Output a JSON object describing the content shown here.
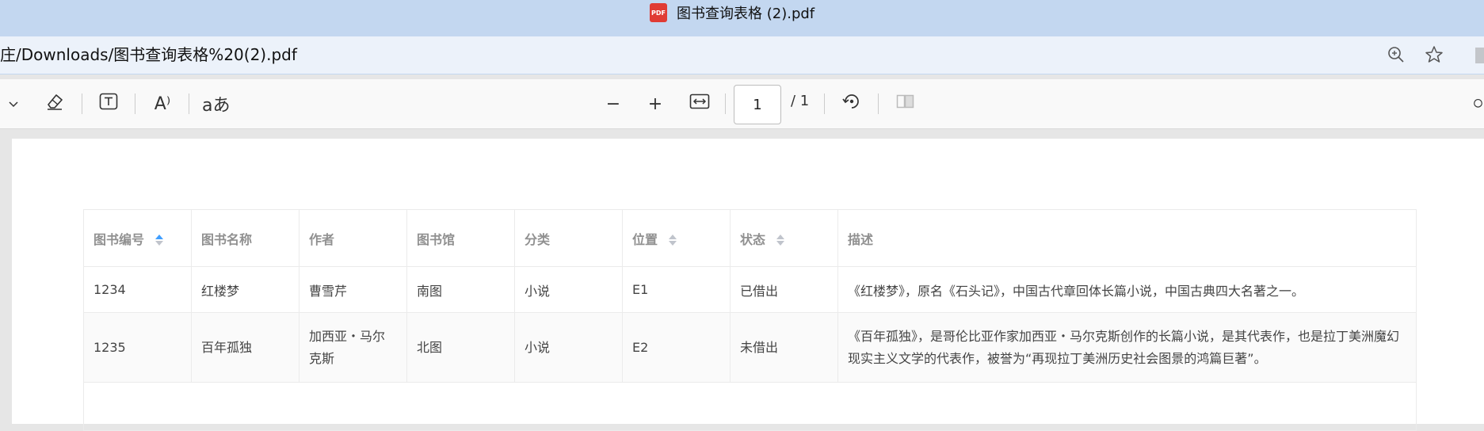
{
  "window": {
    "title": "图书查询表格 (2).pdf",
    "badge": "PDF"
  },
  "address_bar": {
    "url": "庄/Downloads/图书查询表格%20(2).pdf"
  },
  "toolbar": {
    "read_aloud_label": "A⁾",
    "translate_label": "aあ",
    "zoom_out_label": "−",
    "zoom_in_label": "+",
    "page_current": "1",
    "page_total": "/ 1"
  },
  "table": {
    "headers": [
      "图书编号",
      "图书名称",
      "作者",
      "图书馆",
      "分类",
      "位置",
      "状态",
      "描述"
    ],
    "rows": [
      [
        "1234",
        "红楼梦",
        "曹雪芹",
        "南图",
        "小说",
        "E1",
        "已借出",
        "《红楼梦》，原名《石头记》，中国古代章回体长篇小说，中国古典四大名著之一。"
      ],
      [
        "1235",
        "百年孤独",
        "加西亚・马尔克斯",
        "北图",
        "小说",
        "E2",
        "未借出",
        "《百年孤独》，是哥伦比亚作家加西亚・马尔克斯创作的长篇小说，是其代表作，也是拉丁美洲魔幻现实主义文学的代表作，被誉为“再现拉丁美洲历史社会图景的鸿篇巨著”。"
      ]
    ]
  },
  "colors": {
    "sort_active": "#409eff",
    "sort_inactive": "#c0c4cc"
  }
}
